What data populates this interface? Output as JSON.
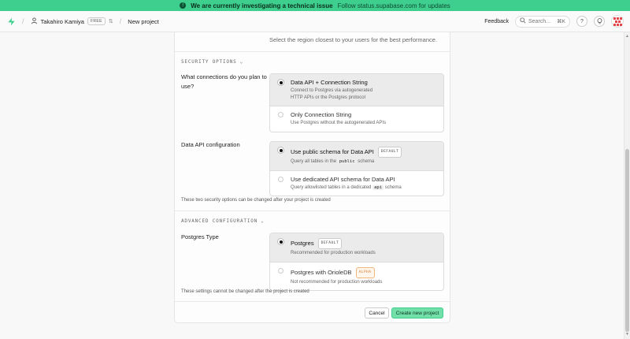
{
  "banner": {
    "icon": "alert-icon",
    "message": "We are currently investigating a technical issue",
    "link_text": "Follow status.supabase.com for updates"
  },
  "topbar": {
    "org_name": "Takahiro Kamiya",
    "plan_badge": "FREE",
    "page_title": "New project",
    "feedback_label": "Feedback",
    "search_placeholder": "Search...",
    "search_shortcut": "⌘K",
    "help_icon": "?"
  },
  "form": {
    "region_hint": "Select the region closest to your users for the best performance.",
    "security": {
      "section_title": "SECURITY OPTIONS",
      "connections_question": "What connections do you plan to use?",
      "connections_options": [
        {
          "title": "Data API + Connection String",
          "desc_line1": "Connect to Postgres via autogenerated",
          "desc_line2": "HTTP APIs or the Postgres protocol",
          "selected": true
        },
        {
          "title": "Only Connection String",
          "desc_line1": "Use Postgres without the autogenerated APIs",
          "selected": false
        }
      ],
      "data_api_label": "Data API configuration",
      "data_api_options": [
        {
          "title": "Use public schema for Data API",
          "badge": "DEFAULT",
          "desc_pre": "Query all tables in the",
          "desc_code": "public",
          "desc_post": "schema",
          "selected": true
        },
        {
          "title": "Use dedicated API schema for Data API",
          "desc_pre": "Query allowlisted tables in a dedicated",
          "desc_code": "api",
          "desc_post": "schema",
          "selected": false
        }
      ],
      "note": "These two security options can be changed after your project is created"
    },
    "advanced": {
      "section_title": "ADVANCED CONFIGURATION",
      "postgres_type_label": "Postgres Type",
      "options": [
        {
          "title": "Postgres",
          "badge": "DEFAULT",
          "desc": "Recommended for production workloads",
          "selected": true
        },
        {
          "title": "Postgres with OrioleDB",
          "badge": "ALPHA",
          "desc": "Not recommended for production workloads",
          "selected": false
        }
      ],
      "note": "These settings cannot be changed after the project is created"
    },
    "cancel_label": "Cancel",
    "create_label": "Create new project"
  },
  "colors": {
    "brand": "#3ecf8e",
    "selected_option_bg": "#ebebeb",
    "alpha_badge": "#d9772b"
  }
}
